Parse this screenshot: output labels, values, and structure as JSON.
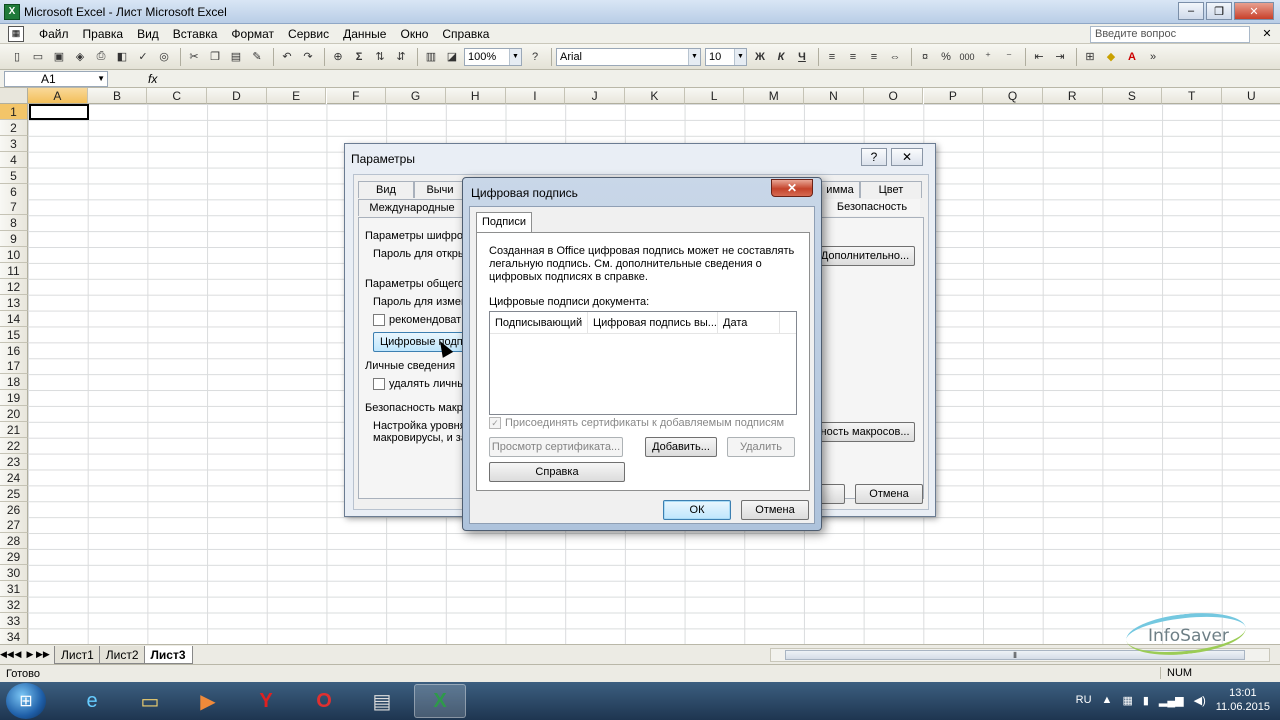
{
  "window": {
    "title": "Microsoft Excel - Лист Microsoft Excel",
    "controls": [
      "–",
      "❐",
      "✕"
    ]
  },
  "menu": {
    "items": [
      "Файл",
      "Правка",
      "Вид",
      "Вставка",
      "Формат",
      "Сервис",
      "Данные",
      "Окно",
      "Справка"
    ],
    "help_placeholder": "Введите вопрос",
    "close": "✕"
  },
  "toolbar": {
    "zoom": "100%",
    "font": "Arial",
    "size": "10",
    "bold": "Ж",
    "italic": "К",
    "underline": "Ч",
    "percent": "%",
    "thousands": "000",
    "sigma": "Σ"
  },
  "formula": {
    "cell_ref": "A1",
    "fx": "fx"
  },
  "grid": {
    "columns": [
      "A",
      "B",
      "C",
      "D",
      "E",
      "F",
      "G",
      "H",
      "I",
      "J",
      "K",
      "L",
      "M",
      "N",
      "O",
      "P",
      "Q",
      "R",
      "S",
      "T",
      "U"
    ],
    "rows": [
      "1",
      "2",
      "3",
      "4",
      "5",
      "6",
      "7",
      "8",
      "9",
      "10",
      "11",
      "12",
      "13",
      "14",
      "15",
      "16",
      "17",
      "18",
      "19",
      "20",
      "21",
      "22",
      "23",
      "24",
      "25",
      "26",
      "27",
      "28",
      "29",
      "30",
      "31",
      "32",
      "33",
      "34"
    ]
  },
  "sheets": {
    "tabs": [
      "Лист1",
      "Лист2",
      "Лист3"
    ],
    "active": "Лист3",
    "nav": [
      "◀◀",
      "◀",
      "▶",
      "▶▶"
    ]
  },
  "status": {
    "ready": "Готово",
    "num": "NUM"
  },
  "taskbar": {
    "lang": "RU",
    "time": "13:01",
    "date": "11.06.2015"
  },
  "watermark": {
    "text": "InfoSaver"
  },
  "params_dialog": {
    "title": "Параметры",
    "help": "?",
    "close": "✕",
    "tabs_row1": [
      "Вид",
      "Вычи",
      "имма",
      "Цвет"
    ],
    "tabs_row2": [
      "Международные",
      "Безопасность"
    ],
    "section1": "Параметры шифрова",
    "open_password": "Пароль для откры",
    "section2": "Параметры общего д",
    "modify_password": "Пароль для измене",
    "recommend": "рекомендовать",
    "digital_sig_btn": "Цифровые подпи",
    "personal": "Личные сведения",
    "remove_personal": "удалять личны",
    "macro_security": "Безопасность макрос",
    "macro_desc_1": "Настройка уровня",
    "macro_desc_2": "макровирусы, и за",
    "advanced_btn": "Дополнительно...",
    "macro_btn": "ность макросов...",
    "cancel_btn": "Отмена"
  },
  "sig_dialog": {
    "title": "Цифровая подпись",
    "close": "✕",
    "tab": "Подписи",
    "description": "Созданная в Office цифровая подпись может не составлять легальную подпись. См. дополнительные сведения о цифровых подписях в справке.",
    "list_label": "Цифровые подписи документа:",
    "columns": [
      "Подписывающий",
      "Цифровая подпись вы...",
      "Дата"
    ],
    "attach_certs": "Присоединять сертификаты к добавляемым подписям",
    "view_cert_btn": "Просмотр сертификата...",
    "add_btn": "Добавить...",
    "remove_btn": "Удалить",
    "help_btn": "Справка",
    "ok_btn": "ОК",
    "cancel_btn": "Отмена"
  }
}
